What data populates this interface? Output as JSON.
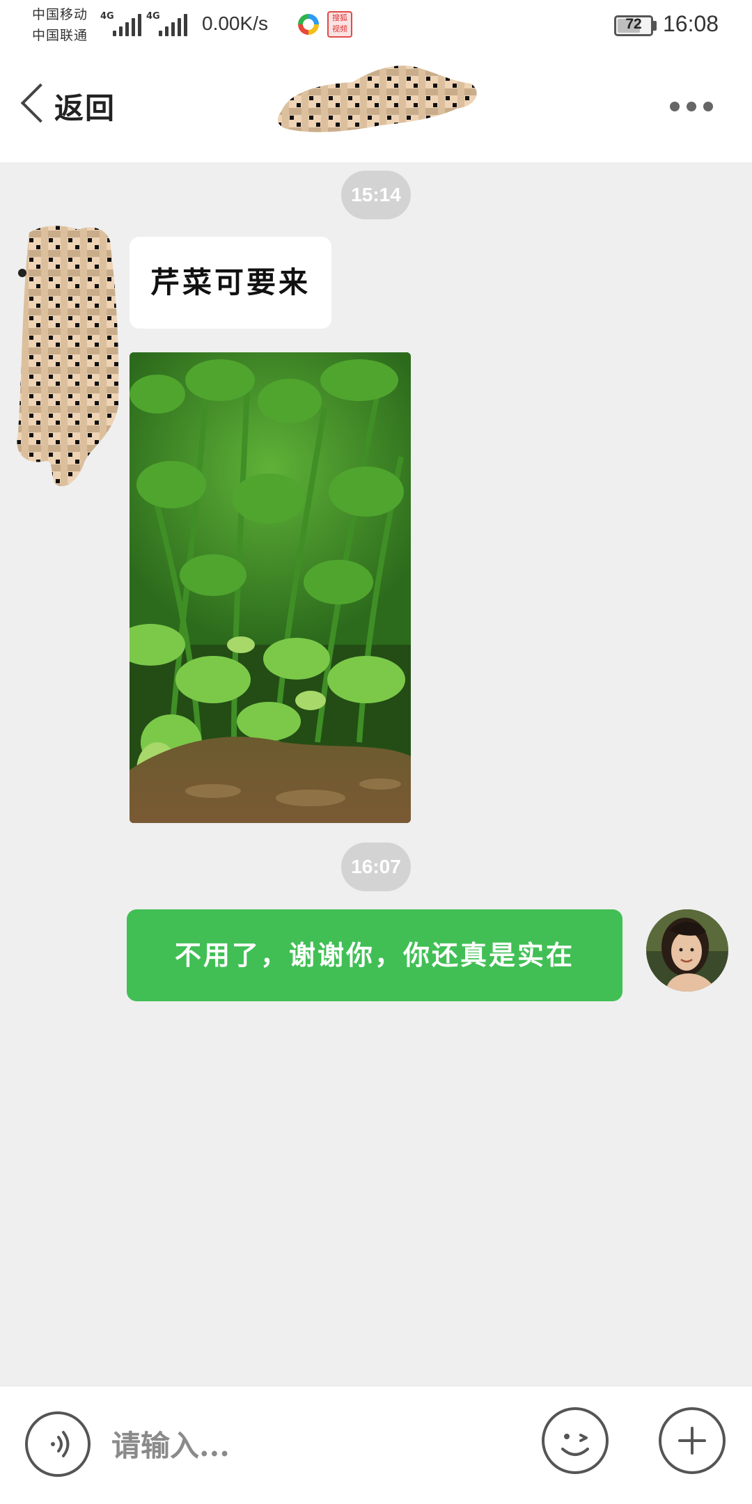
{
  "status_bar": {
    "carrier_1": "中国移动",
    "carrier_2": "中国联通",
    "network_1": "4G",
    "network_2": "4G",
    "speed": "0.00K/s",
    "sohu_icon_text": "搜狐视频",
    "battery": "72",
    "battery_level": 0.72,
    "time": "16:08"
  },
  "header": {
    "back_label": "返回"
  },
  "chat": {
    "messages": [
      {
        "type": "timestamp",
        "text": "15:14"
      },
      {
        "type": "text",
        "sender": "contact",
        "text": "芹菜可要来"
      },
      {
        "type": "image",
        "sender": "contact",
        "subject": "celery-plants"
      },
      {
        "type": "timestamp",
        "text": "16:07"
      },
      {
        "type": "text",
        "sender": "me",
        "text": "不用了，谢谢你，你还真是实在"
      }
    ]
  },
  "input_bar": {
    "placeholder": "请输入..."
  },
  "colors": {
    "outgoing_bubble": "#41bf55",
    "incoming_bubble": "#ffffff",
    "chat_background": "#efefef",
    "timestamp_pill": "#d3d3d3"
  },
  "icons": [
    "voice-icon",
    "emoji-icon",
    "plus-icon",
    "more-icon",
    "back-chevron-icon",
    "battery-icon",
    "signal-icon"
  ]
}
